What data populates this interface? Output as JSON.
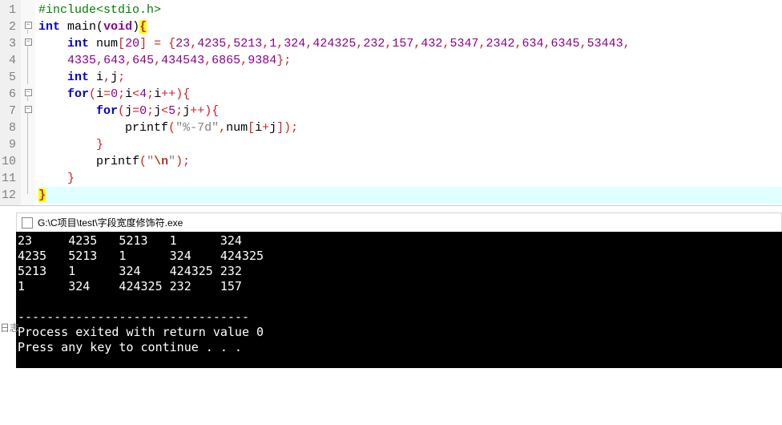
{
  "editor": {
    "lines": [
      {
        "n": "1",
        "fold": "",
        "code": [
          [
            "pp",
            "#include"
          ],
          [
            "pp",
            "<stdio.h>"
          ]
        ]
      },
      {
        "n": "2",
        "fold": "box",
        "code": [
          [
            "kw",
            "int"
          ],
          [
            "id",
            " main"
          ],
          [
            "punc",
            "("
          ],
          [
            "type",
            "void"
          ],
          [
            "punc",
            ")"
          ],
          [
            "brace-hl",
            "{"
          ]
        ]
      },
      {
        "n": "3",
        "fold": "box",
        "code": [
          [
            "id",
            "    "
          ],
          [
            "kw",
            "int"
          ],
          [
            "id",
            " num"
          ],
          [
            "op",
            "["
          ],
          [
            "num",
            "20"
          ],
          [
            "op",
            "]"
          ],
          [
            "id",
            " "
          ],
          [
            "op",
            "="
          ],
          [
            "id",
            " "
          ],
          [
            "op",
            "{"
          ],
          [
            "num",
            "23"
          ],
          [
            "op",
            ","
          ],
          [
            "num",
            "4235"
          ],
          [
            "op",
            ","
          ],
          [
            "num",
            "5213"
          ],
          [
            "op",
            ","
          ],
          [
            "num",
            "1"
          ],
          [
            "op",
            ","
          ],
          [
            "num",
            "324"
          ],
          [
            "op",
            ","
          ],
          [
            "num",
            "424325"
          ],
          [
            "op",
            ","
          ],
          [
            "num",
            "232"
          ],
          [
            "op",
            ","
          ],
          [
            "num",
            "157"
          ],
          [
            "op",
            ","
          ],
          [
            "num",
            "432"
          ],
          [
            "op",
            ","
          ],
          [
            "num",
            "5347"
          ],
          [
            "op",
            ","
          ],
          [
            "num",
            "2342"
          ],
          [
            "op",
            ","
          ],
          [
            "num",
            "634"
          ],
          [
            "op",
            ","
          ],
          [
            "num",
            "6345"
          ],
          [
            "op",
            ","
          ],
          [
            "num",
            "53443"
          ],
          [
            "op",
            ","
          ]
        ]
      },
      {
        "n": "4",
        "fold": "line",
        "code": [
          [
            "id",
            "    "
          ],
          [
            "num",
            "4335"
          ],
          [
            "op",
            ","
          ],
          [
            "num",
            "643"
          ],
          [
            "op",
            ","
          ],
          [
            "num",
            "645"
          ],
          [
            "op",
            ","
          ],
          [
            "num",
            "434543"
          ],
          [
            "op",
            ","
          ],
          [
            "num",
            "6865"
          ],
          [
            "op",
            ","
          ],
          [
            "num",
            "9384"
          ],
          [
            "op",
            "};"
          ]
        ]
      },
      {
        "n": "5",
        "fold": "line",
        "code": [
          [
            "id",
            "    "
          ],
          [
            "kw",
            "int"
          ],
          [
            "id",
            " i"
          ],
          [
            "op",
            ","
          ],
          [
            "id",
            "j"
          ],
          [
            "op",
            ";"
          ]
        ]
      },
      {
        "n": "6",
        "fold": "box",
        "code": [
          [
            "id",
            "    "
          ],
          [
            "kw",
            "for"
          ],
          [
            "op",
            "("
          ],
          [
            "id",
            "i"
          ],
          [
            "op",
            "="
          ],
          [
            "num",
            "0"
          ],
          [
            "op",
            ";"
          ],
          [
            "id",
            "i"
          ],
          [
            "op",
            "<"
          ],
          [
            "num",
            "4"
          ],
          [
            "op",
            ";"
          ],
          [
            "id",
            "i"
          ],
          [
            "op",
            "++){"
          ]
        ]
      },
      {
        "n": "7",
        "fold": "box",
        "code": [
          [
            "id",
            "        "
          ],
          [
            "kw",
            "for"
          ],
          [
            "op",
            "("
          ],
          [
            "id",
            "j"
          ],
          [
            "op",
            "="
          ],
          [
            "num",
            "0"
          ],
          [
            "op",
            ";"
          ],
          [
            "id",
            "j"
          ],
          [
            "op",
            "<"
          ],
          [
            "num",
            "5"
          ],
          [
            "op",
            ";"
          ],
          [
            "id",
            "j"
          ],
          [
            "op",
            "++){"
          ]
        ]
      },
      {
        "n": "8",
        "fold": "line",
        "code": [
          [
            "id",
            "            printf"
          ],
          [
            "op",
            "("
          ],
          [
            "str",
            "\"%-7d\""
          ],
          [
            "op",
            ","
          ],
          [
            "id",
            "num"
          ],
          [
            "op",
            "["
          ],
          [
            "id",
            "i"
          ],
          [
            "op",
            "+"
          ],
          [
            "id",
            "j"
          ],
          [
            "op",
            "]);"
          ]
        ]
      },
      {
        "n": "9",
        "fold": "line",
        "code": [
          [
            "id",
            "        "
          ],
          [
            "op",
            "}"
          ]
        ]
      },
      {
        "n": "10",
        "fold": "line",
        "code": [
          [
            "id",
            "        printf"
          ],
          [
            "op",
            "("
          ],
          [
            "str",
            "\""
          ],
          [
            "esc",
            "\\n"
          ],
          [
            "str",
            "\""
          ],
          [
            "op",
            ");"
          ]
        ]
      },
      {
        "n": "11",
        "fold": "line",
        "code": [
          [
            "id",
            "    "
          ],
          [
            "op",
            "}"
          ]
        ]
      },
      {
        "n": "12",
        "fold": "end",
        "hl": true,
        "code": [
          [
            "brace-hl",
            "}"
          ]
        ]
      }
    ]
  },
  "console": {
    "title": "G:\\C项目\\test\\字段宽度修饰符.exe",
    "rows": [
      [
        "23",
        "4235",
        "5213",
        "1",
        "324"
      ],
      [
        "4235",
        "5213",
        "1",
        "324",
        "424325"
      ],
      [
        "5213",
        "1",
        "324",
        "424325",
        "232"
      ],
      [
        "1",
        "324",
        "424325",
        "232",
        "157"
      ]
    ],
    "sep": "--------------------------------",
    "exit": "Process exited with return value 0",
    "press": "Press any key to continue . . ."
  },
  "side": "日志"
}
